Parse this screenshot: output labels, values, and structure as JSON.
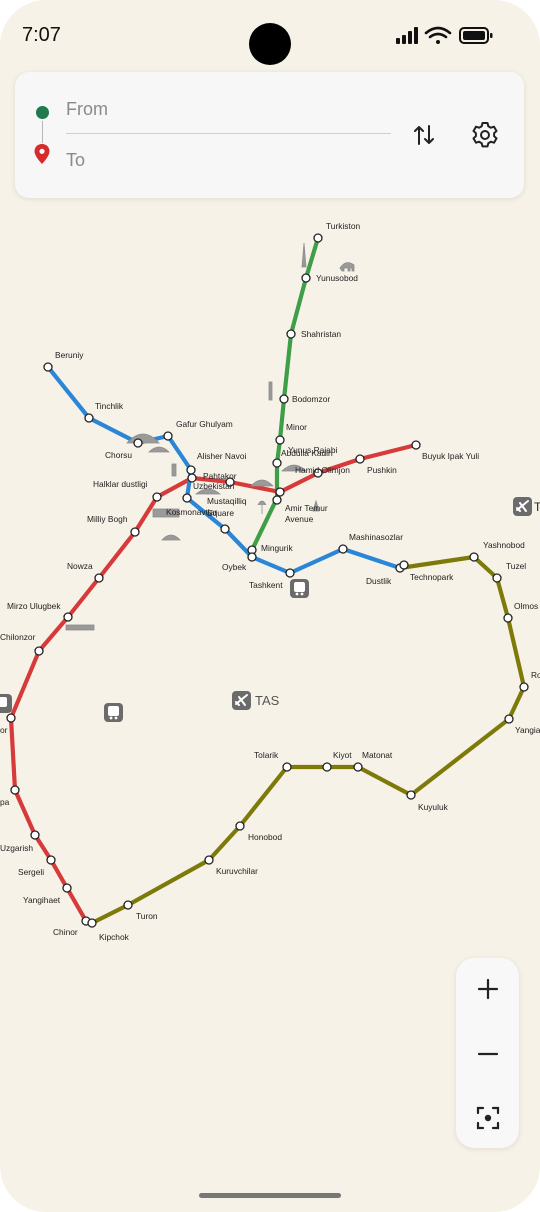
{
  "status_bar": {
    "time": "7:07"
  },
  "search": {
    "from_placeholder": "From",
    "to_placeholder": "To"
  },
  "colors": {
    "green_line": "#3f9e48",
    "red_line": "#d63a3a",
    "blue_line": "#2b86d8",
    "olive_line": "#7d7a0a",
    "background": "#f7f2e7",
    "from_dot": "#1f7a4d",
    "to_pin": "#d62b2b"
  },
  "map": {
    "airport_label": "TAS",
    "lines": [
      {
        "name": "green",
        "stations": [
          "Turkiston",
          "Yunusobod",
          "Shahristan",
          "Bodomzor",
          "Minor",
          "Abdulla Kadiri",
          "Yunus Rajabi",
          "Mingurik"
        ]
      },
      {
        "name": "red",
        "stations": [
          "Buyuk Ipak Yuli",
          "Pushkin",
          "Hamid Olimjon",
          "Amir Temur Avenue",
          "Mustaqilliq Square",
          "Pahtakor",
          "Halklar dustligi",
          "Milliy Bogh",
          "Nowza",
          "Mirzo Ulugbek",
          "Chilonzor",
          "Olmazor",
          "Olmos",
          "Uzgarish",
          "Sergeli",
          "Yangihaet",
          "Chinor"
        ]
      },
      {
        "name": "blue",
        "stations": [
          "Beruniy",
          "Tinchlik",
          "Chorsu",
          "Gafur Ghulyam",
          "Alisher Navoi",
          "Uzbekistan",
          "Kosmonavtlar",
          "Oybek",
          "Tashkent",
          "Mashinasozlar",
          "Dustlik"
        ]
      },
      {
        "name": "olive",
        "stations": [
          "Dustlik",
          "Technopark",
          "Yashnobod",
          "Tuzel",
          "Olmos",
          "Rohat",
          "Yangiabad",
          "Kuyuluk",
          "Matonat",
          "Kiyot",
          "Tolarik",
          "Honobod",
          "Kuruvchilar",
          "Turon",
          "Kipchok",
          "Chinor"
        ]
      }
    ],
    "station_labels": [
      "Turkiston",
      "Yunusobod",
      "Shahristan",
      "Bodomzor",
      "Minor",
      "Abdulla Kadiri",
      "Yunus Rajabi",
      "Hamid Olimjon",
      "Amir Temur",
      "Avenue",
      "Pushkin",
      "Buyuk Ipak Yuli",
      "Mashinasozlar",
      "Dustlik",
      "Technopark",
      "Yashnobod",
      "Tuzel",
      "Olmos",
      "Ro",
      "Yangia",
      "Kuyuluk",
      "Matonat",
      "Kiyot",
      "Tolarik",
      "Honobod",
      "Kuruvchilar",
      "Turon",
      "Kipchok",
      "Chinor",
      "Yangihaet",
      "Sergeli",
      "Uzgarish",
      "pa",
      "or",
      "Chilonzor",
      "Mirzo Ulugbek",
      "Nowza",
      "Milliy Bogh",
      "Halklar dustligi",
      "Pahtakor",
      "Uzbekistan",
      "Alisher Navoi",
      "Mustaqilliq",
      "Square",
      "Kosmonavtlar",
      "Oybek",
      "Mingurik",
      "Tashkent",
      "Gafur Ghulyam",
      "Chorsu",
      "Tinchlik",
      "Beruniy"
    ]
  },
  "controls": {
    "zoom_in": "zoom-in",
    "zoom_out": "zoom-out",
    "recenter": "recenter"
  }
}
